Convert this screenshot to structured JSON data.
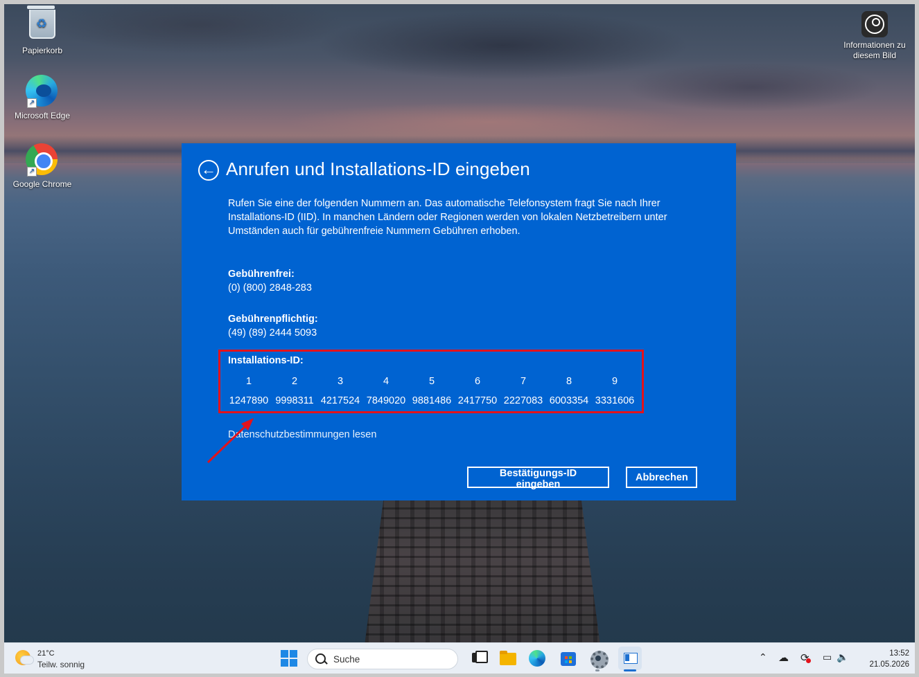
{
  "desktop": {
    "icons": [
      {
        "label": "Papierkorb",
        "icon": "recycle-bin-icon"
      },
      {
        "label": "Microsoft Edge",
        "icon": "edge-icon"
      },
      {
        "label": "Google Chrome",
        "icon": "chrome-icon"
      }
    ],
    "info_label": "Informationen zu diesem Bild"
  },
  "dialog": {
    "title": "Anrufen und Installations-ID eingeben",
    "description": "Rufen Sie eine der folgenden Nummern an. Das automatische Telefonsystem fragt Sie nach Ihrer Installations-ID (IID). In manchen Ländern oder Regionen werden von lokalen Netzbetreibern unter Umständen auch für gebührenfreie Nummern Gebühren erhoben.",
    "tollfree_label": "Gebührenfrei:",
    "tollfree_number": "(0) (800) 2848-283",
    "toll_label": "Gebührenpflichtig:",
    "toll_number": "(49) (89) 2444 5093",
    "iid_label": "Installations-ID:",
    "iid_groups": [
      {
        "index": "1",
        "value": "1247890"
      },
      {
        "index": "2",
        "value": "9998311"
      },
      {
        "index": "3",
        "value": "4217524"
      },
      {
        "index": "4",
        "value": "7849020"
      },
      {
        "index": "5",
        "value": "9881486"
      },
      {
        "index": "6",
        "value": "2417750"
      },
      {
        "index": "7",
        "value": "2227083"
      },
      {
        "index": "8",
        "value": "6003354"
      },
      {
        "index": "9",
        "value": "3331606"
      }
    ],
    "privacy_link": "Datenschutzbestimmungen lesen",
    "confirm_button": "Bestätigungs-ID eingeben",
    "cancel_button": "Abbrechen",
    "accent": "#0063d1",
    "highlight_color": "#e4121b"
  },
  "taskbar": {
    "weather_temp": "21°C",
    "weather_desc": "Teilw. sonnig",
    "search_placeholder": "Suche",
    "time": "13:52",
    "date": "21.05.2026"
  }
}
